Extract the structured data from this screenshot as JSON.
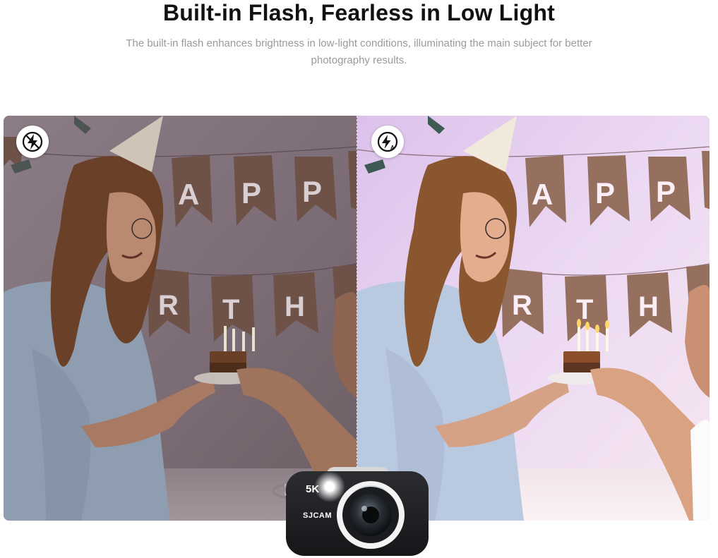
{
  "section": {
    "title": "Built-in Flash, Fearless in Low Light",
    "description": "The built-in flash enhances brightness in low-light conditions, illuminating the main subject for better photography results."
  },
  "comparison": {
    "left_icon": "flash-off-icon",
    "right_icon": "flash-auto-icon",
    "banner_top": [
      "A",
      "P",
      "P"
    ],
    "banner_bottom": [
      "R",
      "T",
      "H"
    ],
    "colors": {
      "left_wall": "#857780",
      "right_wall": "#e7d3ee",
      "banner_left": "#6e5248",
      "banner_right": "#95705f"
    }
  },
  "camera": {
    "resolution_label": "5K",
    "brand_label": "SJCAM"
  }
}
